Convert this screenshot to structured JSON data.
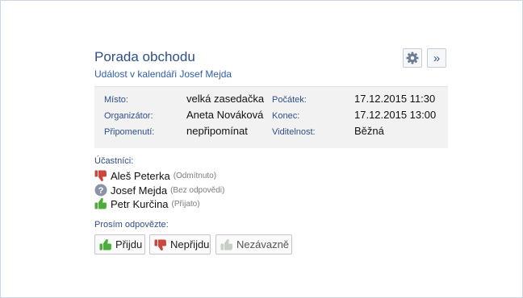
{
  "event": {
    "title": "Porada obchodu",
    "subtitle": "Událost v kalendáři Josef Mejda"
  },
  "toolbar": {
    "settings_icon": "gear-icon",
    "more_label": "»"
  },
  "details": {
    "place_label": "Místo:",
    "place_value": "velká zasedačka",
    "start_label": "Počátek:",
    "start_value": "17.12.2015 11:30",
    "organizer_label": "Organizátor:",
    "organizer_value": "Aneta Nováková",
    "end_label": "Konec:",
    "end_value": "17.12.2015 13:00",
    "reminder_label": "Připomenutí:",
    "reminder_value": "nepřipomínat",
    "visibility_label": "Viditelnost:",
    "visibility_value": "Běžná"
  },
  "participants": {
    "label": "Účastníci:",
    "items": [
      {
        "name": "Aleš Peterka",
        "status": "(Odmítnuto)",
        "icon": "thumbs-down-icon"
      },
      {
        "name": "Josef Mejda",
        "status": "(Bez odpovědi)",
        "icon": "question-icon"
      },
      {
        "name": "Petr Kurčina",
        "status": "(Přijato)",
        "icon": "thumbs-up-icon"
      }
    ]
  },
  "response": {
    "label": "Prosím odpovězte:",
    "accept_label": "Přijdu",
    "decline_label": "Nepřijdu",
    "tentative_label": "Nezávazně"
  },
  "colors": {
    "title": "#2f4e8c",
    "link": "#2f5fa8",
    "accept": "#4cae3a",
    "decline": "#c9473e",
    "unknown": "#8a94a6",
    "tentative": "#c5cfc3"
  }
}
